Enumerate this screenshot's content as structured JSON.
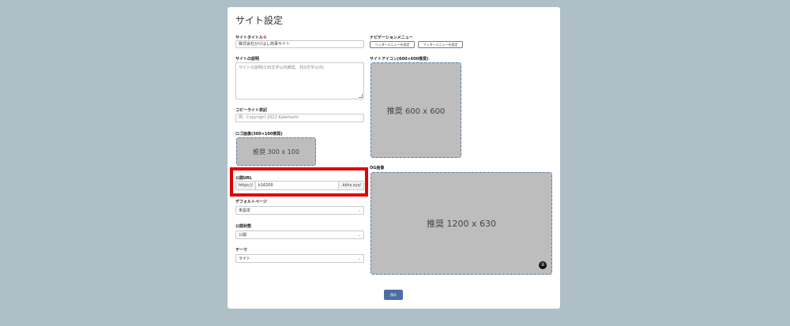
{
  "page": {
    "title": "サイト設定"
  },
  "fields": {
    "site_title": {
      "label": "サイトタイトル",
      "required_mark": "※",
      "value": "株式会社かけはし商事サイト"
    },
    "site_description": {
      "label": "サイトの説明",
      "placeholder": "サイトの説明(130文字以内推奨、350文字以内)"
    },
    "copyright": {
      "label": "コピーライト表記",
      "placeholder": "例：Copyright 2022 Kakehashi"
    },
    "logo": {
      "label": "ロゴ画像(300×100推奨)",
      "placeholder_text": "推奨 300 x 100"
    },
    "public_url": {
      "label": "公開URL",
      "prefix": "https://",
      "value": "k16200",
      "suffix": ".kkhs.xyz/"
    },
    "default_page": {
      "label": "デフォルトページ",
      "value": "未設定"
    },
    "publish_status": {
      "label": "公開状態",
      "value": "公開"
    },
    "theme": {
      "label": "テーマ",
      "value": "ライト"
    },
    "navigation": {
      "label": "ナビゲーションメニュー",
      "header_button": "ヘッダーメニューを設定",
      "footer_button": "フッターメニューを設定"
    },
    "site_icon": {
      "label": "サイトアイコン(600×600推奨)",
      "placeholder_text": "推奨 600 x 600"
    },
    "og_image": {
      "label": "OG画像",
      "placeholder_text": "推奨 1200 x 630",
      "badge": "②"
    }
  },
  "actions": {
    "save_label": "保存"
  },
  "colors": {
    "highlight": "#e00000",
    "primary_button": "#4a6fa5",
    "placeholder_bg": "#bdbdbd",
    "page_bg": "#aebfc7"
  }
}
